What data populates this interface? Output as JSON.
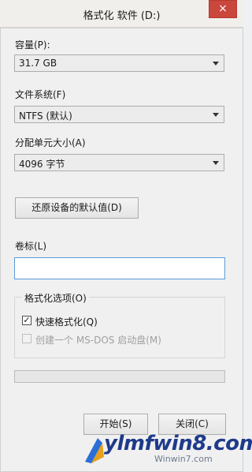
{
  "window": {
    "title": "格式化 软件 (D:)",
    "close_glyph": "×"
  },
  "capacity": {
    "label": "容量(P):",
    "value": "31.7 GB"
  },
  "filesystem": {
    "label": "文件系统(F)",
    "value": "NTFS (默认)"
  },
  "allocation": {
    "label": "分配单元大小(A)",
    "value": "4096 字节"
  },
  "restore_button": "还原设备的默认值(D)",
  "volume": {
    "label": "卷标(L)",
    "value": ""
  },
  "format_options": {
    "legend": "格式化选项(O)",
    "quick_format": {
      "label": "快速格式化(Q)",
      "checked": true,
      "check_glyph": "✓"
    },
    "msdos_disk": {
      "label": "创建一个 MS-DOS 启动盘(M)",
      "checked": false,
      "enabled": false
    }
  },
  "progress": {
    "fraction": 0
  },
  "buttons": {
    "start": "开始(S)",
    "close": "关闭(C)"
  },
  "watermark": {
    "text": "ylmfwin8.com",
    "sub": "Winwin7.com"
  },
  "edge_digit": "2",
  "colors": {
    "close_button": "#c9473c",
    "input_focus": "#5a9bd6"
  }
}
